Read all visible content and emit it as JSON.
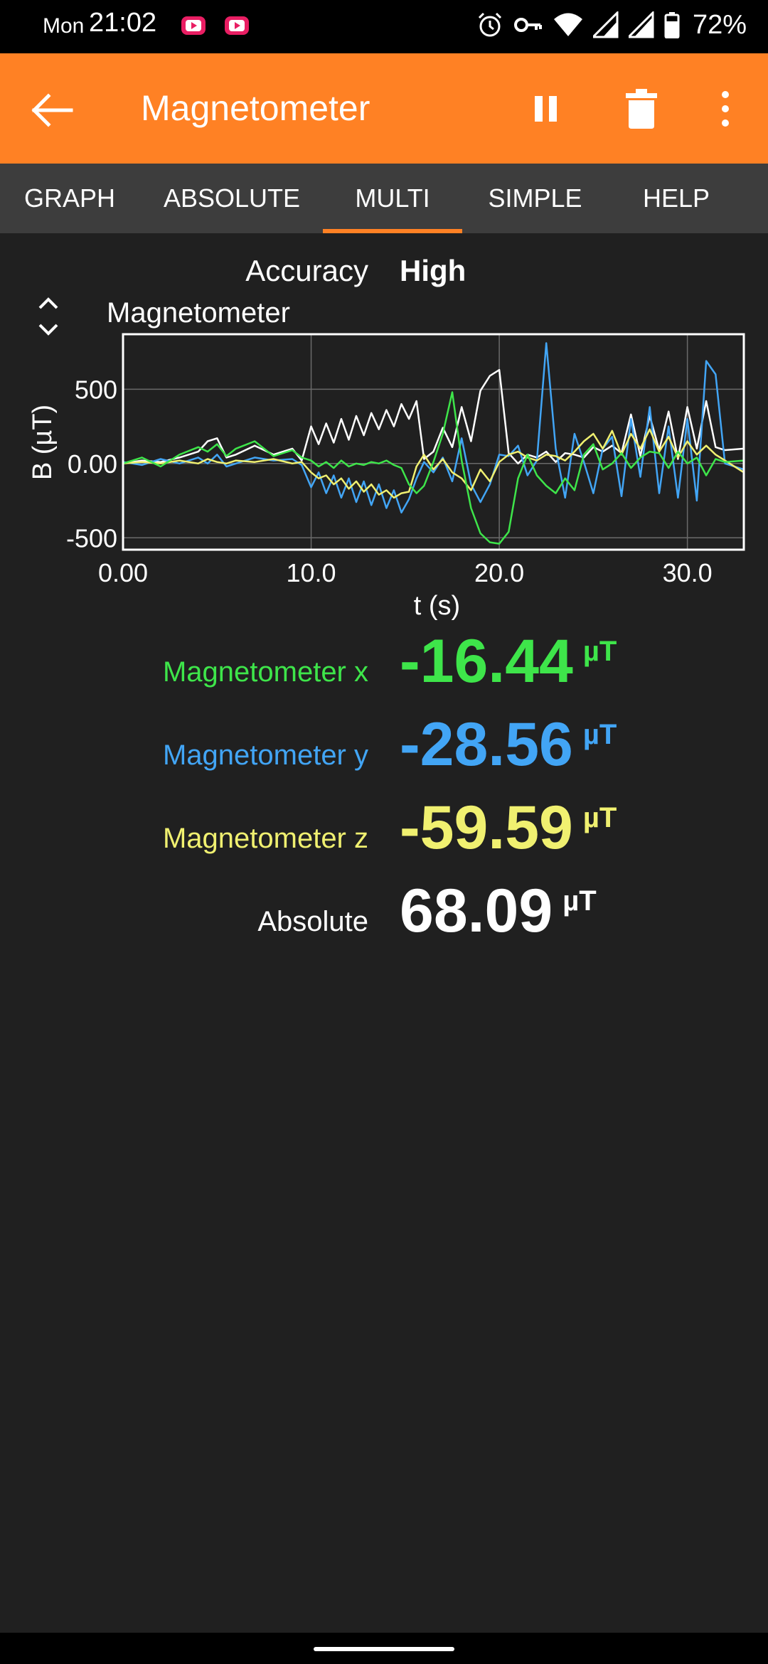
{
  "status_bar": {
    "day": "Mon",
    "time": "21:02",
    "battery": "72%",
    "icons": [
      "youtube-notification-icon",
      "youtube-notification-icon",
      "alarm-icon",
      "vpn-key-icon",
      "wifi-icon",
      "signal-icon",
      "signal-icon",
      "battery-icon"
    ]
  },
  "app_bar": {
    "title": "Magnetometer",
    "icons": [
      "back-arrow-icon",
      "pause-icon",
      "delete-icon",
      "more-vert-icon"
    ],
    "color": "#ff8124"
  },
  "tabs": [
    {
      "label": "GRAPH",
      "selected": false
    },
    {
      "label": "ABSOLUTE",
      "selected": false
    },
    {
      "label": "MULTI",
      "selected": true
    },
    {
      "label": "SIMPLE",
      "selected": false
    },
    {
      "label": "HELP",
      "selected": false
    }
  ],
  "accuracy": {
    "label": "Accuracy",
    "value": "High"
  },
  "graph_section": {
    "title": "Magnetometer",
    "expand_icon": "expand-collapse-icon"
  },
  "chart_data": {
    "type": "line",
    "title": "Magnetometer",
    "xlabel": "t (s)",
    "ylabel": "B (µT)",
    "xlim": [
      0,
      33
    ],
    "ylim": [
      -580,
      870
    ],
    "x_ticks": [
      0,
      10,
      20,
      30
    ],
    "x_tick_labels": [
      "0.00",
      "10.0",
      "20.0",
      "30.0"
    ],
    "y_ticks": [
      500,
      0,
      -500
    ],
    "y_tick_labels": [
      "500",
      "0.00",
      "-500"
    ],
    "grid": true,
    "series": [
      {
        "color": "#ffffff",
        "x": [
          0,
          1,
          2,
          3,
          4,
          4.5,
          5,
          5.5,
          6,
          7,
          8,
          9,
          9.5,
          10,
          10.4,
          10.8,
          11.2,
          11.6,
          12,
          12.4,
          12.8,
          13.2,
          13.6,
          14,
          14.4,
          14.8,
          15.2,
          15.6,
          16,
          16.5,
          17,
          17.5,
          18,
          18.5,
          19,
          19.5,
          20,
          20.5,
          21,
          21.5,
          22,
          22.5,
          23,
          23.5,
          24,
          24.5,
          25,
          25.5,
          26,
          26.5,
          27,
          27.5,
          28,
          28.5,
          29,
          29.5,
          30,
          30.5,
          31,
          31.5,
          32,
          33
        ],
        "y": [
          0,
          20,
          10,
          40,
          80,
          150,
          170,
          40,
          60,
          120,
          60,
          100,
          20,
          250,
          130,
          270,
          140,
          300,
          160,
          320,
          190,
          340,
          230,
          360,
          250,
          400,
          300,
          420,
          30,
          80,
          240,
          110,
          380,
          150,
          490,
          590,
          630,
          70,
          0,
          60,
          40,
          80,
          10,
          70,
          60,
          40,
          110,
          80,
          120,
          70,
          330,
          50,
          320,
          90,
          350,
          30,
          380,
          100,
          420,
          110,
          90,
          100
        ]
      },
      {
        "color": "#42a5f5",
        "x": [
          0,
          1,
          2,
          3,
          4,
          4.5,
          5,
          5.5,
          6,
          7,
          8,
          9,
          9.5,
          10,
          10.4,
          10.8,
          11.2,
          11.6,
          12,
          12.4,
          12.8,
          13.2,
          13.6,
          14,
          14.4,
          14.8,
          15.2,
          15.6,
          16,
          16.5,
          17,
          17.5,
          18,
          18.5,
          19,
          19.5,
          20,
          20.5,
          21,
          21.5,
          22,
          22.5,
          23,
          23.5,
          24,
          24.5,
          25,
          25.5,
          26,
          26.5,
          27,
          27.5,
          28,
          28.5,
          29,
          29.5,
          30,
          30.5,
          31,
          31.5,
          32,
          33
        ],
        "y": [
          10,
          -10,
          30,
          0,
          40,
          0,
          60,
          -20,
          0,
          40,
          20,
          30,
          -10,
          -160,
          -60,
          -200,
          -80,
          -230,
          -100,
          -260,
          -120,
          -280,
          -140,
          -300,
          -180,
          -330,
          -240,
          -100,
          10,
          -60,
          40,
          -120,
          170,
          -140,
          -260,
          -140,
          60,
          50,
          120,
          -80,
          20,
          810,
          100,
          -230,
          200,
          10,
          -200,
          100,
          180,
          -220,
          300,
          -90,
          380,
          -200,
          250,
          -230,
          300,
          -250,
          690,
          600,
          0,
          -40
        ]
      },
      {
        "color": "#f0f070",
        "x": [
          0,
          1,
          2,
          3,
          4,
          4.5,
          5,
          5.5,
          6,
          7,
          8,
          9,
          9.5,
          10,
          10.4,
          10.8,
          11.2,
          11.6,
          12,
          12.4,
          12.8,
          13.2,
          13.6,
          14,
          14.4,
          14.8,
          15.2,
          15.6,
          16,
          16.5,
          17,
          17.5,
          18,
          18.5,
          19,
          19.5,
          20,
          20.5,
          21,
          21.5,
          22,
          22.5,
          23,
          23.5,
          24,
          24.5,
          25,
          25.5,
          26,
          26.5,
          27,
          27.5,
          28,
          28.5,
          29,
          29.5,
          30,
          30.5,
          31,
          31.5,
          32,
          33
        ],
        "y": [
          0,
          10,
          0,
          20,
          0,
          30,
          10,
          0,
          20,
          10,
          30,
          0,
          10,
          -60,
          -100,
          -80,
          -140,
          -100,
          -170,
          -120,
          -190,
          -140,
          -210,
          -180,
          -230,
          -200,
          -190,
          -20,
          60,
          -40,
          30,
          -60,
          -100,
          -180,
          -40,
          -120,
          10,
          60,
          80,
          40,
          20,
          60,
          50,
          20,
          80,
          150,
          200,
          100,
          220,
          60,
          200,
          100,
          230,
          80,
          180,
          40,
          150,
          60,
          120,
          60,
          20,
          -60
        ]
      },
      {
        "color": "#3ee54a",
        "x": [
          0,
          1,
          2,
          3,
          4,
          4.5,
          5,
          5.5,
          6,
          7,
          8,
          9,
          9.5,
          10,
          10.4,
          10.8,
          11.2,
          11.6,
          12,
          12.4,
          12.8,
          13.2,
          13.6,
          14,
          14.4,
          14.8,
          15.2,
          15.6,
          16,
          16.5,
          17,
          17.5,
          18,
          18.5,
          19,
          19.5,
          20,
          20.5,
          21,
          21.5,
          22,
          22.5,
          23,
          23.5,
          24,
          24.5,
          25,
          25.5,
          26,
          26.5,
          27,
          27.5,
          28,
          28.5,
          29,
          29.5,
          30,
          30.5,
          31,
          31.5,
          32,
          33
        ],
        "y": [
          0,
          40,
          -20,
          60,
          110,
          80,
          130,
          50,
          100,
          150,
          50,
          90,
          40,
          20,
          -20,
          10,
          -30,
          20,
          -20,
          0,
          -10,
          10,
          0,
          20,
          -10,
          -30,
          -140,
          -200,
          -150,
          10,
          200,
          480,
          20,
          -300,
          -470,
          -530,
          -540,
          -460,
          -100,
          60,
          -80,
          -150,
          -200,
          -100,
          -180,
          60,
          130,
          -40,
          0,
          70,
          -30,
          40,
          80,
          70,
          -30,
          80,
          0,
          40,
          -80,
          30,
          10,
          20
        ]
      }
    ]
  },
  "readings": [
    {
      "label": "Magnetometer x",
      "value": "-16.44",
      "unit": "µT",
      "color": "#3ee54a"
    },
    {
      "label": "Magnetometer y",
      "value": "-28.56",
      "unit": "µT",
      "color": "#42a5f5"
    },
    {
      "label": "Magnetometer z",
      "value": "-59.59",
      "unit": "µT",
      "color": "#f0f070"
    },
    {
      "label": "Absolute",
      "value": "68.09",
      "unit": "µT",
      "color": "#ffffff"
    }
  ]
}
